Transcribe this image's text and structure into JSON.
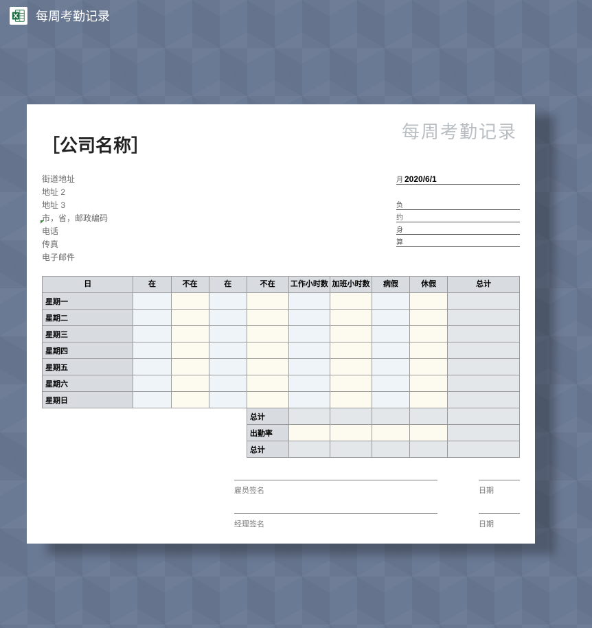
{
  "header": {
    "title": "每周考勤记录"
  },
  "sheet": {
    "watermark": "每周考勤记录",
    "company_name": "［公司名称］",
    "address": {
      "street": "街道地址",
      "addr2": "地址 2",
      "addr3": "地址 3",
      "city_line": "市，省，邮政编码",
      "phone": "电话",
      "fax": "传真",
      "email": "电子邮件"
    },
    "right_info": {
      "date_prefix": "月",
      "date_value": "2020/6/1",
      "line2_prefix": "负",
      "line3_prefix": "约",
      "line4_prefix": "身",
      "line5_prefix": "算"
    },
    "table": {
      "headers": {
        "day": "日",
        "in1": "在",
        "out1": "不在",
        "in2": "在",
        "out2": "不在",
        "work": "工作小时数",
        "ot": "加班小时数",
        "sick": "病假",
        "vac": "休假",
        "total": "总计"
      },
      "days": [
        "星期一",
        "星期二",
        "星期三",
        "星期四",
        "星期五",
        "星期六",
        "星期日"
      ],
      "summary": {
        "total": "总计",
        "rate": "出勤率",
        "grand": "总计"
      }
    },
    "signatures": {
      "employee": "雇员签名",
      "manager": "经理签名",
      "date": "日期"
    }
  }
}
